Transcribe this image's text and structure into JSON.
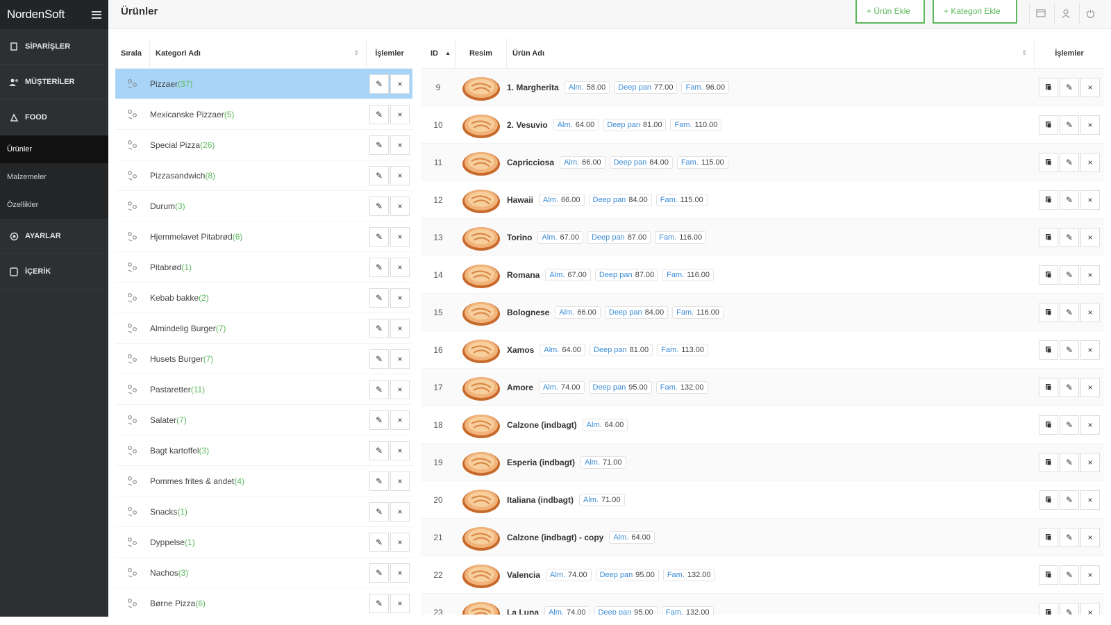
{
  "brand": "NordenSoft",
  "nav": [
    {
      "label": "SİPARİŞLER",
      "icon": "orders-icon"
    },
    {
      "label": "MÜŞTERİLER",
      "icon": "customers-icon"
    },
    {
      "label": "FOOD",
      "icon": "food-icon"
    }
  ],
  "subnav": [
    {
      "label": "Ürünler",
      "active": true
    },
    {
      "label": "Malzemeler",
      "active": false
    },
    {
      "label": "Özellikler",
      "active": false
    }
  ],
  "nav2": [
    {
      "label": "AYARLAR",
      "icon": "settings-icon"
    },
    {
      "label": "İÇERİK",
      "icon": "content-icon"
    }
  ],
  "header": {
    "title": "Ürünler",
    "add_product": "+ Ürün Ekle",
    "add_category": "+ Kategori Ekle"
  },
  "categories": {
    "headers": {
      "order": "Sırala",
      "name": "Kategori Adı",
      "ops": "İşlemler"
    },
    "rows": [
      {
        "name": "Pizzaer",
        "count": "(37)",
        "selected": true
      },
      {
        "name": "Mexicanske Pizzaer",
        "count": "(5)"
      },
      {
        "name": "Special Pizza",
        "count": "(26)"
      },
      {
        "name": "Pizzasandwich",
        "count": "(8)"
      },
      {
        "name": "Durum",
        "count": "(3)"
      },
      {
        "name": "Hjemmelavet Pitabrød",
        "count": "(6)"
      },
      {
        "name": "Pitabrød",
        "count": "(1)"
      },
      {
        "name": "Kebab bakke",
        "count": "(2)"
      },
      {
        "name": "Almindelig Burger",
        "count": "(7)"
      },
      {
        "name": "Husets Burger",
        "count": "(7)"
      },
      {
        "name": "Pastaretter",
        "count": "(11)"
      },
      {
        "name": "Salater",
        "count": "(7)"
      },
      {
        "name": "Bagt kartoffel",
        "count": "(3)"
      },
      {
        "name": "Pommes frites & andet",
        "count": "(4)"
      },
      {
        "name": "Snacks",
        "count": "(1)"
      },
      {
        "name": "Dyppelse",
        "count": "(1)"
      },
      {
        "name": "Nachos",
        "count": "(3)"
      },
      {
        "name": "Børne Pizza",
        "count": "(6)"
      }
    ]
  },
  "products": {
    "headers": {
      "id": "ID",
      "image": "Resim",
      "name": "Ürün Adı",
      "ops": "İşlemler"
    },
    "rows": [
      {
        "id": "9",
        "name": "1. Margherita",
        "prices": [
          [
            "Alm.",
            "58.00"
          ],
          [
            "Deep pan",
            "77.00"
          ],
          [
            "Fam.",
            "96.00"
          ]
        ]
      },
      {
        "id": "10",
        "name": "2. Vesuvio",
        "prices": [
          [
            "Alm.",
            "64.00"
          ],
          [
            "Deep pan",
            "81.00"
          ],
          [
            "Fam.",
            "110.00"
          ]
        ]
      },
      {
        "id": "11",
        "name": "Capricciosa",
        "prices": [
          [
            "Alm.",
            "66.00"
          ],
          [
            "Deep pan",
            "84.00"
          ],
          [
            "Fam.",
            "115.00"
          ]
        ]
      },
      {
        "id": "12",
        "name": "Hawaii",
        "prices": [
          [
            "Alm.",
            "66.00"
          ],
          [
            "Deep pan",
            "84.00"
          ],
          [
            "Fam.",
            "115.00"
          ]
        ]
      },
      {
        "id": "13",
        "name": "Torino",
        "prices": [
          [
            "Alm.",
            "67.00"
          ],
          [
            "Deep pan",
            "87.00"
          ],
          [
            "Fam.",
            "116.00"
          ]
        ]
      },
      {
        "id": "14",
        "name": "Romana",
        "prices": [
          [
            "Alm.",
            "67.00"
          ],
          [
            "Deep pan",
            "87.00"
          ],
          [
            "Fam.",
            "116.00"
          ]
        ]
      },
      {
        "id": "15",
        "name": "Bolognese",
        "prices": [
          [
            "Alm.",
            "66.00"
          ],
          [
            "Deep pan",
            "84.00"
          ],
          [
            "Fam.",
            "116.00"
          ]
        ]
      },
      {
        "id": "16",
        "name": "Xamos",
        "prices": [
          [
            "Alm.",
            "64.00"
          ],
          [
            "Deep pan",
            "81.00"
          ],
          [
            "Fam.",
            "113.00"
          ]
        ]
      },
      {
        "id": "17",
        "name": "Amore",
        "prices": [
          [
            "Alm.",
            "74.00"
          ],
          [
            "Deep pan",
            "95.00"
          ],
          [
            "Fam.",
            "132.00"
          ]
        ]
      },
      {
        "id": "18",
        "name": "Calzone (indbagt)",
        "prices": [
          [
            "Alm.",
            "64.00"
          ]
        ]
      },
      {
        "id": "19",
        "name": "Esperia (indbagt)",
        "prices": [
          [
            "Alm.",
            "71.00"
          ]
        ]
      },
      {
        "id": "20",
        "name": "Italiana (indbagt)",
        "prices": [
          [
            "Alm.",
            "71.00"
          ]
        ]
      },
      {
        "id": "21",
        "name": "Calzone (indbagt) - copy",
        "prices": [
          [
            "Alm.",
            "64.00"
          ]
        ]
      },
      {
        "id": "22",
        "name": "Valencia",
        "prices": [
          [
            "Alm.",
            "74.00"
          ],
          [
            "Deep pan",
            "95.00"
          ],
          [
            "Fam.",
            "132.00"
          ]
        ]
      },
      {
        "id": "23",
        "name": "La Luna",
        "prices": [
          [
            "Alm.",
            "74.00"
          ],
          [
            "Deep pan",
            "95.00"
          ],
          [
            "Fam.",
            "132.00"
          ]
        ]
      }
    ]
  },
  "colors": {
    "sidebar": "#2d3033",
    "accent_green": "#5cb85c",
    "selected_row": "#a8d5f7",
    "price_label": "#3a8bd6"
  }
}
